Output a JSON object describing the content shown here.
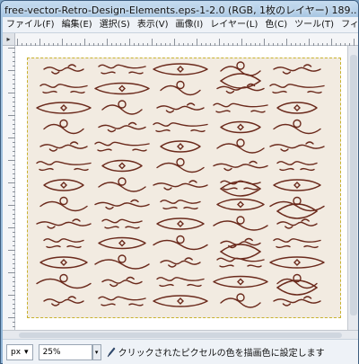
{
  "window": {
    "title": "free-vector-Retro-Design-Elements.eps-1-2.0 (RGB, 1枚のレイヤー) 189..."
  },
  "menubar": {
    "items": [
      {
        "label": "ファイル(F)"
      },
      {
        "label": "編集(E)"
      },
      {
        "label": "選択(S)"
      },
      {
        "label": "表示(V)"
      },
      {
        "label": "画像(I)"
      },
      {
        "label": "レイヤー(L)"
      },
      {
        "label": "色(C)"
      },
      {
        "label": "ツール(T)"
      },
      {
        "label": "フィルタ(R)"
      }
    ]
  },
  "canvas": {
    "image_background": "#f2ebe1",
    "ornament_color": "#6b2a1c"
  },
  "statusbar": {
    "unit": "px",
    "zoom": "25%",
    "message": "クリックされたピクセルの色を描画色に設定します"
  }
}
